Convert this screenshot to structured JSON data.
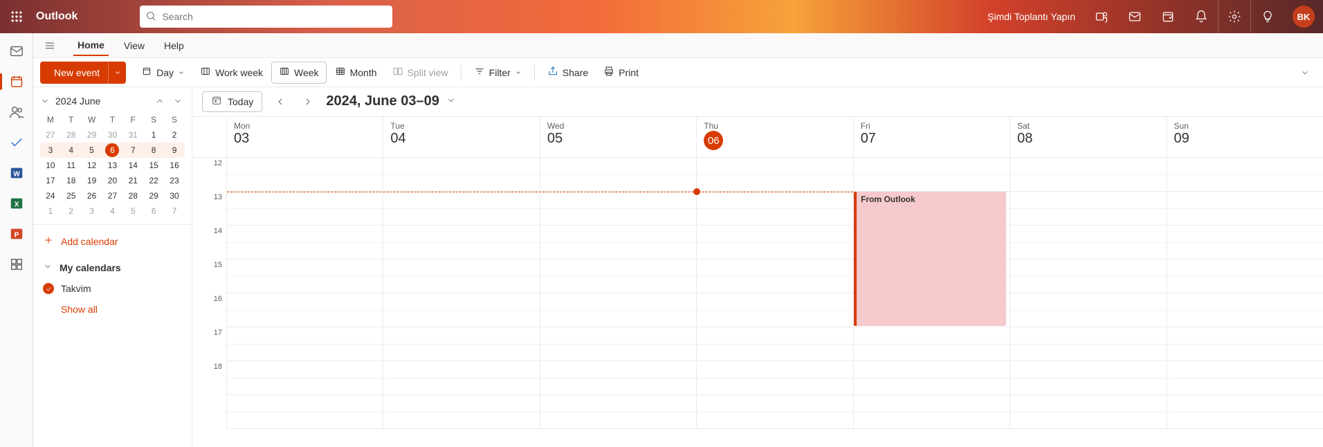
{
  "brand": "Outlook",
  "search_placeholder": "Search",
  "meet_now": "Şimdi Toplantı Yapın",
  "avatar_initials": "BK",
  "tabs": {
    "home": "Home",
    "view": "View",
    "help": "Help"
  },
  "toolbar": {
    "new_event": "New event",
    "day": "Day",
    "work_week": "Work week",
    "week": "Week",
    "month": "Month",
    "split_view": "Split view",
    "filter": "Filter",
    "share": "Share",
    "print": "Print"
  },
  "today_btn": "Today",
  "range_title": "2024, June 03–09",
  "mini_cal": {
    "title": "2024 June",
    "dow": [
      "M",
      "T",
      "W",
      "T",
      "F",
      "S",
      "S"
    ],
    "weeks": [
      [
        {
          "d": "27",
          "dim": true
        },
        {
          "d": "28",
          "dim": true
        },
        {
          "d": "29",
          "dim": true
        },
        {
          "d": "30",
          "dim": true
        },
        {
          "d": "31",
          "dim": true
        },
        {
          "d": "1"
        },
        {
          "d": "2"
        }
      ],
      [
        {
          "d": "3"
        },
        {
          "d": "4"
        },
        {
          "d": "5"
        },
        {
          "d": "6",
          "today": true
        },
        {
          "d": "7"
        },
        {
          "d": "8"
        },
        {
          "d": "9"
        }
      ],
      [
        {
          "d": "10"
        },
        {
          "d": "11"
        },
        {
          "d": "12"
        },
        {
          "d": "13"
        },
        {
          "d": "14"
        },
        {
          "d": "15"
        },
        {
          "d": "16"
        }
      ],
      [
        {
          "d": "17"
        },
        {
          "d": "18"
        },
        {
          "d": "19"
        },
        {
          "d": "20"
        },
        {
          "d": "21"
        },
        {
          "d": "22"
        },
        {
          "d": "23"
        }
      ],
      [
        {
          "d": "24"
        },
        {
          "d": "25"
        },
        {
          "d": "26"
        },
        {
          "d": "27"
        },
        {
          "d": "28"
        },
        {
          "d": "29"
        },
        {
          "d": "30"
        }
      ],
      [
        {
          "d": "1",
          "dim": true
        },
        {
          "d": "2",
          "dim": true
        },
        {
          "d": "3",
          "dim": true
        },
        {
          "d": "4",
          "dim": true
        },
        {
          "d": "5",
          "dim": true
        },
        {
          "d": "6",
          "dim": true
        },
        {
          "d": "7",
          "dim": true
        }
      ]
    ],
    "current_week_index": 1
  },
  "add_calendar": "Add calendar",
  "my_calendars": "My calendars",
  "calendar_item": "Takvim",
  "show_all": "Show all",
  "days": [
    {
      "name": "Mon",
      "num": "03"
    },
    {
      "name": "Tue",
      "num": "04"
    },
    {
      "name": "Wed",
      "num": "05"
    },
    {
      "name": "Thu",
      "num": "06",
      "today": true
    },
    {
      "name": "Fri",
      "num": "07"
    },
    {
      "name": "Sat",
      "num": "08"
    },
    {
      "name": "Sun",
      "num": "09"
    }
  ],
  "hours": [
    "12",
    "13",
    "14",
    "15",
    "16",
    "17",
    "18",
    ""
  ],
  "event": {
    "title": "From Outlook",
    "day_index": 4,
    "start_hour_index": 1,
    "end_hour_index": 5
  },
  "now": {
    "day_index": 3,
    "hour_index": 1,
    "frac": 0
  }
}
